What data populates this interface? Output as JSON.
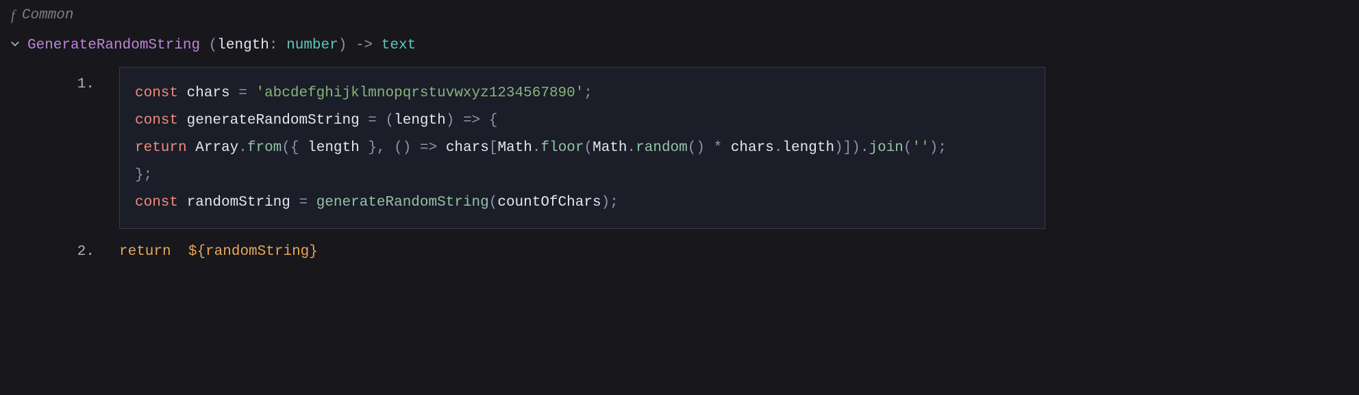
{
  "breadcrumb": {
    "icon_label": "f",
    "label": "Common"
  },
  "signature": {
    "name": "GenerateRandomString",
    "param_name": "length",
    "param_type": "number",
    "arrow": "->",
    "return_type": "text",
    "open_paren": "(",
    "close_paren": ")",
    "colon": ":"
  },
  "steps": {
    "one": {
      "num": "1."
    },
    "two": {
      "num": "2."
    }
  },
  "code": {
    "l1": {
      "kw": "const",
      "ident": "chars",
      "eq": "=",
      "str": "'abcdefghijklmnopqrstuvwxyz1234567890'",
      "semi": ";"
    },
    "l2": {
      "kw": "const",
      "ident": "generateRandomString",
      "eq": "=",
      "op1": "(",
      "param": "length",
      "op2": ")",
      "arrow": "=>",
      "brace": "{"
    },
    "l3": {
      "kw": "return",
      "arr": "Array",
      "dot1": ".",
      "from": "from",
      "op1": "(",
      "brace1": "{",
      "len": "length",
      "brace2": "}",
      "comma1": ",",
      "op2": "(",
      "op3": ")",
      "arrow": "=>",
      "chars": "chars",
      "brk1": "[",
      "math": "Math",
      "dot2": ".",
      "floor": "floor",
      "op4": "(",
      "math2": "Math",
      "dot3": ".",
      "random": "random",
      "op5": "(",
      "op6": ")",
      "star": "*",
      "chars2": "chars",
      "dot4": ".",
      "len2": "length",
      "op7": ")",
      "brk2": "]",
      "op8": ")",
      "dot5": ".",
      "join": "join",
      "op9": "(",
      "empty": "''",
      "op10": ")",
      "semi": ";"
    },
    "l4": {
      "brace": "}",
      "semi": ";"
    },
    "l5": {
      "kw": "const",
      "ident": "randomString",
      "eq": "=",
      "call": "generateRandomString",
      "op1": "(",
      "arg": "countOfChars",
      "op2": ")",
      "semi": ";"
    }
  },
  "returns": {
    "kw": "return",
    "expr": "${randomString}"
  }
}
